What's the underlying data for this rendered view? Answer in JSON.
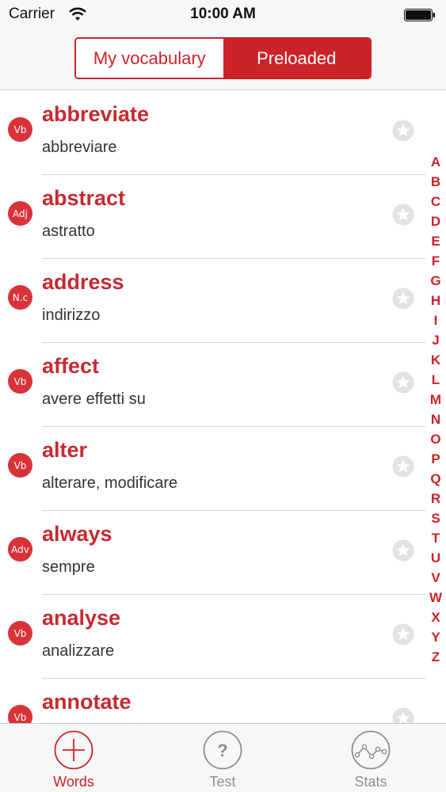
{
  "status_bar": {
    "carrier": "Carrier",
    "time": "10:00 AM",
    "icons": [
      "wifi-icon",
      "battery-icon"
    ]
  },
  "segmented_control": {
    "segments": [
      {
        "label": "My vocabulary",
        "selected": false
      },
      {
        "label": "Preloaded",
        "selected": true
      }
    ]
  },
  "words": [
    {
      "type": "Vb",
      "word": "abbreviate",
      "translation": "abbreviare"
    },
    {
      "type": "Adj",
      "word": "abstract",
      "translation": "astratto"
    },
    {
      "type": "N.c",
      "word": "address",
      "translation": "indirizzo"
    },
    {
      "type": "Vb",
      "word": "affect",
      "translation": "avere effetti su"
    },
    {
      "type": "Vb",
      "word": "alter",
      "translation": "alterare, modificare"
    },
    {
      "type": "Adv",
      "word": "always",
      "translation": "sempre"
    },
    {
      "type": "Vb",
      "word": "analyse",
      "translation": "analizzare"
    },
    {
      "type": "Vb",
      "word": "annotate",
      "translation": ""
    }
  ],
  "alphabet_index": [
    "A",
    "B",
    "C",
    "D",
    "E",
    "F",
    "G",
    "H",
    "I",
    "J",
    "K",
    "L",
    "M",
    "N",
    "O",
    "P",
    "Q",
    "R",
    "S",
    "T",
    "U",
    "V",
    "W",
    "X",
    "Y",
    "Z"
  ],
  "tab_bar": {
    "tabs": [
      {
        "label": "Words",
        "icon": "plus-circle-icon",
        "active": true
      },
      {
        "label": "Test",
        "icon": "question-circle-icon",
        "active": false
      },
      {
        "label": "Stats",
        "icon": "stats-line-icon",
        "active": false
      }
    ]
  },
  "colors": {
    "accent": "#cc2229",
    "badge": "#d9333a",
    "word_text": "#c62a31",
    "inactive": "#8e8e8e"
  }
}
